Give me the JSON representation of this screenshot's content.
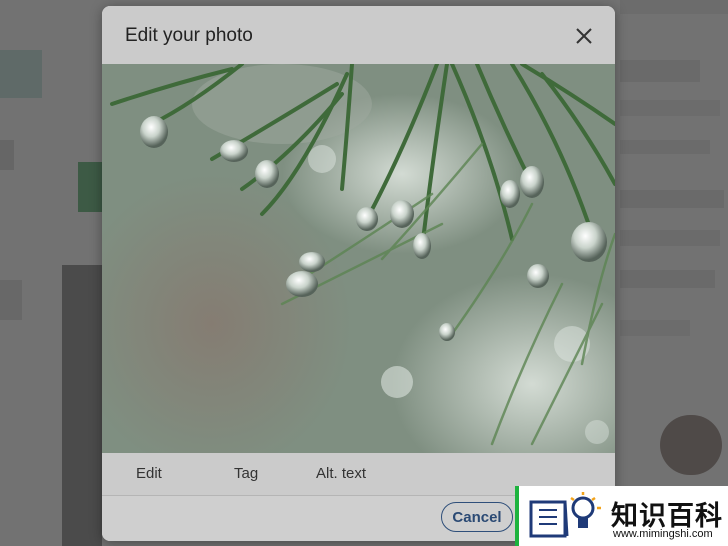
{
  "dialog": {
    "title": "Edit your photo",
    "close_icon": "close-icon",
    "photo_description_icon": "photo-image",
    "tabs": [
      {
        "label": "Edit"
      },
      {
        "label": "Tag"
      },
      {
        "label": "Alt. text"
      }
    ],
    "cancel_label": "Cancel",
    "accent_color": "#2b4a74"
  },
  "watermark": {
    "cn_text": "知识百科",
    "url": "www.mimingshi.com",
    "icon": "book-lightbulb-icon",
    "bar_color": "#1db33e"
  }
}
